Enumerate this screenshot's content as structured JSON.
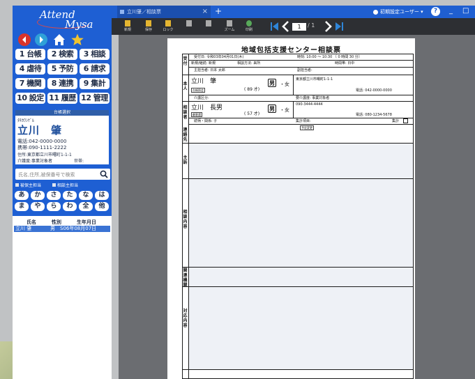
{
  "logo": {
    "line1": "Attend",
    "line2": "Mysa"
  },
  "icons": {
    "back": "arrow-left-icon",
    "forward": "arrow-right-icon",
    "home": "home-icon",
    "favorite": "star-icon",
    "search": "search-icon",
    "page_first": "first-page-icon",
    "page_prev": "prev-page-icon",
    "page_next": "next-page-icon",
    "page_last": "last-page-icon"
  },
  "colors": {
    "sidebar": "#1e5fd3",
    "back": "#d9342b",
    "forward": "#2fa0d8",
    "home": "#ffffff",
    "favorite": "#f2c32e",
    "page_nav": "#2f86d9"
  },
  "menu": [
    {
      "label": "1 台帳"
    },
    {
      "label": "2 検索"
    },
    {
      "label": "3 相談"
    },
    {
      "label": "4 虐待"
    },
    {
      "label": "5 予防"
    },
    {
      "label": "6 請求"
    },
    {
      "label": "7 機関"
    },
    {
      "label": "8 連携"
    },
    {
      "label": "9 集計"
    },
    {
      "label": "10 設定"
    },
    {
      "label": "11 履歴"
    },
    {
      "label": "12 管理"
    }
  ],
  "selected_title": "台帳選択",
  "client": {
    "kana": "ﾀﾁｶﾜｼｹﾞﾙ",
    "name": "立川　肇",
    "phone": "電話:042-0000-0000",
    "mobile": "携帯:090-1111-2222",
    "address": "住所:東京都立川市曙町1-1-1",
    "care": "介護度:事業対象者",
    "household": "世帯:"
  },
  "search": {
    "placeholder": "氏名,住所,被保番号で検索",
    "opt1": "被保主担当",
    "opt2": "相談主担当"
  },
  "kana_buttons": [
    [
      "あ",
      "か",
      "さ",
      "た",
      "な",
      "は"
    ],
    [
      "ま",
      "や",
      "ら",
      "わ",
      "全",
      "他"
    ]
  ],
  "list": {
    "headers": {
      "name": "氏名",
      "sex": "性別",
      "dob": "生年月日"
    },
    "rows": [
      {
        "name": "立川 肇",
        "sex": "男",
        "dob": "S06年08月07日"
      }
    ]
  },
  "tabs": [
    {
      "label": "立川肇／相談票"
    }
  ],
  "new_tab": "+",
  "user": {
    "label": "初期設定ユーザー"
  },
  "help": "?",
  "window": {
    "minimize": "_",
    "maximize": "□"
  },
  "toolbar": {
    "new": "新規",
    "save": "保存",
    "lock": "ロック",
    "zoom": "ズーム",
    "print": "印刷"
  },
  "pager": {
    "current": "1",
    "total": "/ 1"
  },
  "form": {
    "title": "地域包括支援センター相談票",
    "reception_date": "受付日: 令和03年04月01日(木)",
    "time": "時刻: 10:00 〜 10:30 〔 0 時間 30 分〕",
    "new_continue": "新規/継続: 新規",
    "method": "相談方法: 来所",
    "timezone": "時間帯: 日中",
    "responsible": "主担当者: 日本 太郎",
    "sub_responsible": "副担当者:",
    "labels": {
      "reception": "受付",
      "person": "本人",
      "consultant": "相談者",
      "contact": "連絡先",
      "care_level": "介護区分:",
      "needs": "要介護度:",
      "relation": "続柄・関係:",
      "summary": "集計",
      "section_main": "主訴",
      "section_content": "相談内容",
      "section_support": "関連機関",
      "section_response": "対応内容"
    },
    "person": {
      "name": "立川　肇",
      "age": "( 89 才)",
      "male": "男",
      "female": "女",
      "address": "東京都立川市曙町1-1-1",
      "phone": "電話: 042-0000-0000",
      "btn": "台帳照会",
      "needs_value": "事業対象者"
    },
    "consultant": {
      "name": "立川　長男",
      "age": "( 57 才)",
      "male": "男",
      "female": "女",
      "phone": "090-3444-4444",
      "tel": "電話: 080-1234-5678",
      "btn": "顧客選",
      "relation": "子",
      "summary_label": "集計項目:",
      "summary_check": "集計"
    },
    "btn_predict": "予定変更",
    "side_btn1": "選択",
    "side_btn2": "入力"
  }
}
